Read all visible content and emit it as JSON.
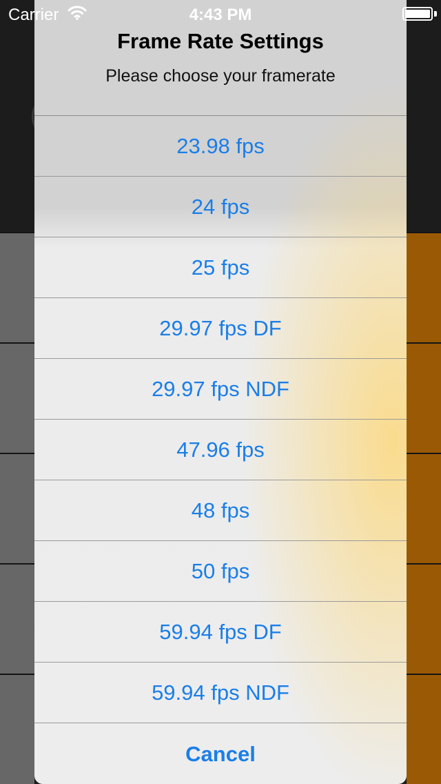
{
  "status_bar": {
    "carrier": "Carrier",
    "time": "4:43 PM",
    "wifi_icon": "wifi-icon",
    "battery_icon": "battery-icon"
  },
  "action_sheet": {
    "title": "Frame Rate Settings",
    "message": "Please choose your framerate",
    "options": [
      "23.98 fps",
      "24 fps",
      "25 fps",
      "29.97 fps DF",
      "29.97 fps NDF",
      "47.96 fps",
      "48 fps",
      "50 fps",
      "59.94 fps DF",
      "59.94 fps NDF"
    ],
    "cancel_label": "Cancel"
  },
  "colors": {
    "button_blue": "#1a7ee8",
    "accent_orange": "#9a5a05",
    "background_dark": "#1c1c1c",
    "gray_cell": "#676767"
  }
}
